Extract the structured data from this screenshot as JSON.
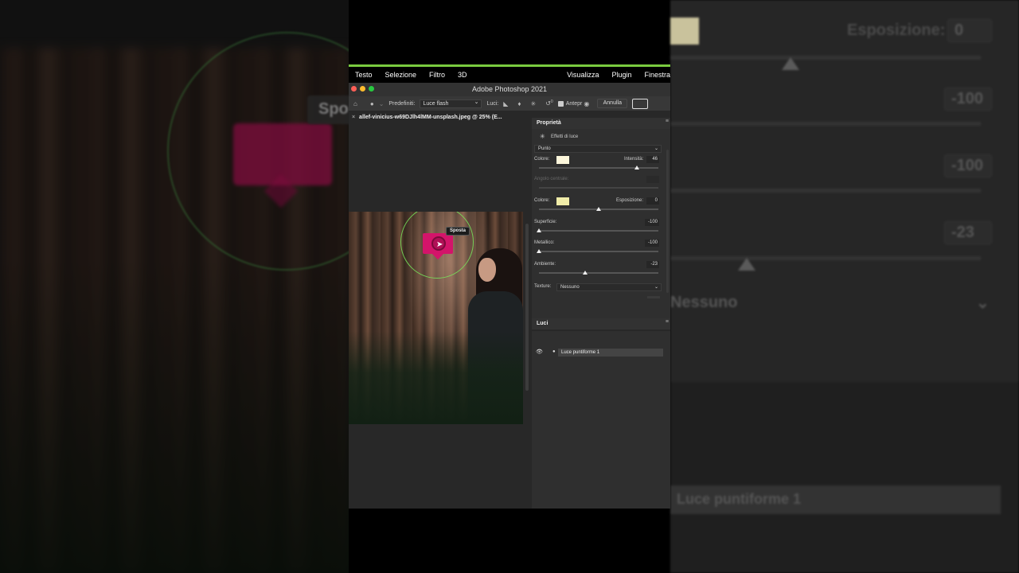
{
  "menu": {
    "items": [
      "Testo",
      "Selezione",
      "Filtro",
      "3D"
    ],
    "right_items": [
      "Visualizza",
      "Plugin",
      "Finestra"
    ]
  },
  "window": {
    "title": "Adobe Photoshop 2021"
  },
  "options": {
    "preset_label": "Predefiniti:",
    "preset_value": "Luce flash",
    "lights_label": "Luci:",
    "preview_label": "Antepr",
    "cancel_label": "Annulla",
    "reset_count": "0"
  },
  "document": {
    "tab": "allef-vinicius-w69DJlh4lMM-unsplash.jpeg @ 25% (E...",
    "tooltip": "Sposta"
  },
  "properties": {
    "title": "Proprietà",
    "effects_label": "Effetti di luce",
    "light_type": "Punto",
    "color_label": "Colore:",
    "intensity_label": "Intensità:",
    "intensity_value": "46",
    "intensity": 0.82,
    "hotspot_label": "Angolo centrale:",
    "color2_label": "Colore:",
    "exposure_label": "Esposizione:",
    "exposure_value": "0",
    "exposure": 0.5,
    "gloss_label": "Superficie:",
    "gloss_value": "-100",
    "gloss": 0.0,
    "metallic_label": "Metallico:",
    "metallic_value": "-100",
    "metallic": 0.0,
    "ambience_label": "Ambiente:",
    "ambience_value": "-23",
    "ambience": 0.385,
    "texture_label": "Texture:",
    "texture_value": "Nessuno",
    "colors": {
      "light": "#fdf7dc",
      "ambient": "#f0eca8"
    }
  },
  "lights_panel": {
    "title": "Luci",
    "layers": [
      "Luce puntiforme 1"
    ]
  },
  "backdrop": {
    "left_tooltip": "Spo",
    "right_exposure_label": "Esposizione:",
    "right_exposure_value": "0",
    "right_values": [
      "-100",
      "-100",
      "-23"
    ],
    "right_texture": "Nessuno",
    "right_layer": "Luce puntiforme 1"
  }
}
